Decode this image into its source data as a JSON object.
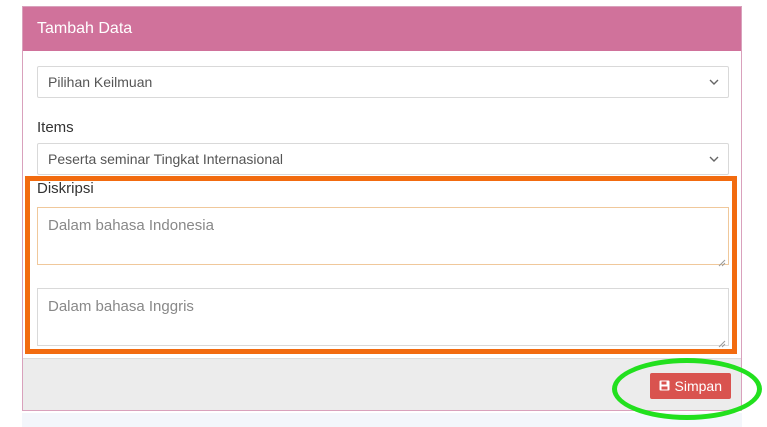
{
  "panel": {
    "title": "Tambah Data",
    "header_color": "#d0729b"
  },
  "form": {
    "field1_value": "Pilihan Keilmuan",
    "items_label": "Items",
    "items_value": "Peserta seminar Tingkat Internasional",
    "description_label": "Diskripsi",
    "desc_id_placeholder": "Dalam bahasa Indonesia",
    "desc_en_placeholder": "Dalam bahasa Inggris"
  },
  "footer": {
    "save_label": "Simpan",
    "save_color": "#d9534f",
    "save_icon": "floppy-disk-icon"
  },
  "annotations": {
    "rect_color": "#f26b0f",
    "ellipse_color": "#22e01e"
  }
}
